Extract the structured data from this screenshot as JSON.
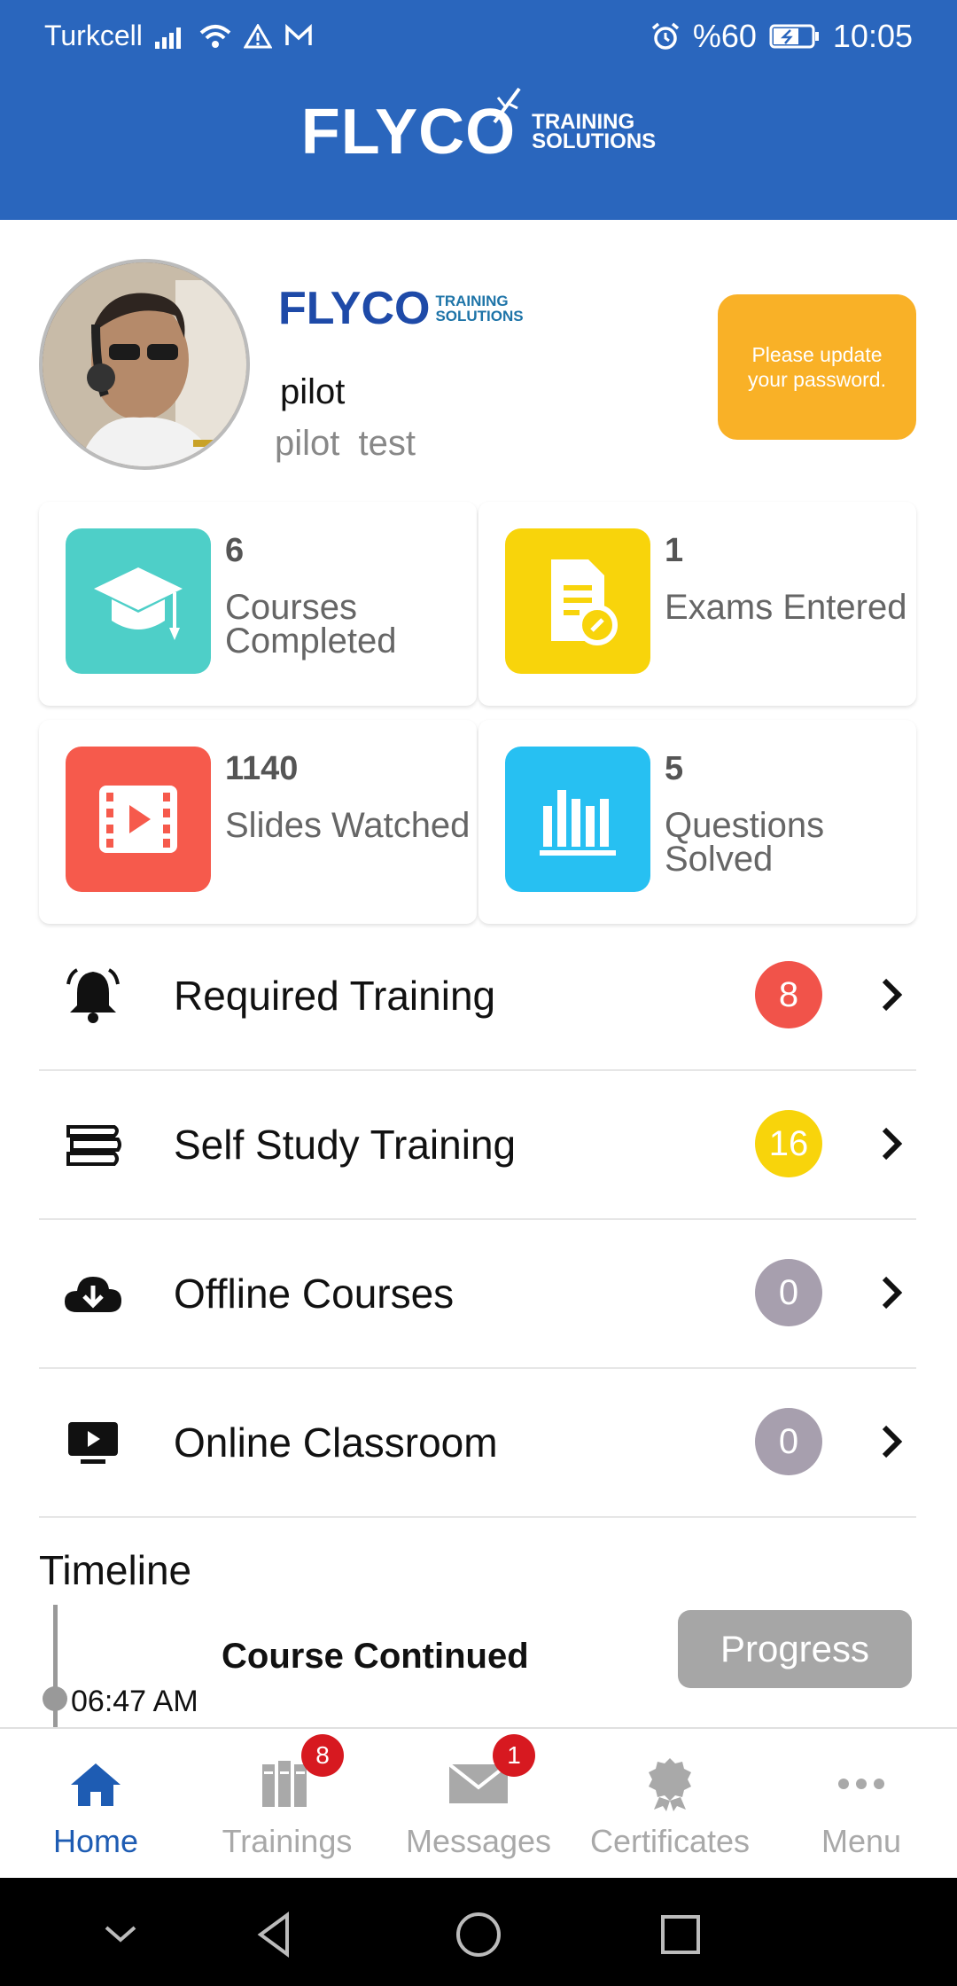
{
  "status_bar": {
    "carrier": "Turkcell",
    "battery": "%60",
    "time": "10:05"
  },
  "header": {
    "brand_word": "FLYCO",
    "brand_line1": "TRAINING",
    "brand_line2": "SOLUTIONS"
  },
  "profile": {
    "brand_word": "FLYCO",
    "brand_line1": "TRAINING",
    "brand_line2": "SOLUTIONS",
    "username": "pilot",
    "full_name": "pilot  test",
    "password_notice": "Please update your password."
  },
  "stats": [
    {
      "value": "6",
      "label": "Courses Completed",
      "icon": "graduation-cap-icon",
      "color": "#4ecfc8"
    },
    {
      "value": "1",
      "label": "Exams Entered",
      "icon": "exam-document-icon",
      "color": "#f8d40b"
    },
    {
      "value": "1140",
      "label": "Slides Watched",
      "icon": "video-slides-icon",
      "color": "#f65a4c"
    },
    {
      "value": "5",
      "label": "Questions Solved",
      "icon": "bar-chart-icon",
      "color": "#27c0f2"
    }
  ],
  "menu": [
    {
      "label": "Required Training",
      "count": "8",
      "icon": "bell-icon",
      "badge_color": "#f1534a"
    },
    {
      "label": "Self Study Training",
      "count": "16",
      "icon": "books-icon",
      "badge_color": "#f8d40b"
    },
    {
      "label": "Offline Courses",
      "count": "0",
      "icon": "cloud-download-icon",
      "badge_color": "#a79fae"
    },
    {
      "label": "Online Classroom",
      "count": "0",
      "icon": "video-screen-icon",
      "badge_color": "#a79fae"
    }
  ],
  "timeline": {
    "title": "Timeline",
    "event": "Course Continued",
    "time": "06:47 AM",
    "action": "Progress"
  },
  "bottom_nav": {
    "tabs": [
      {
        "label": "Home",
        "icon": "home-icon",
        "active": true
      },
      {
        "label": "Trainings",
        "icon": "books-icon",
        "badge": "8"
      },
      {
        "label": "Messages",
        "icon": "envelope-icon",
        "badge": "1"
      },
      {
        "label": "Certificates",
        "icon": "certificate-icon"
      },
      {
        "label": "Menu",
        "icon": "more-dots-icon"
      }
    ]
  },
  "colors": {
    "brand_blue": "#2a66bd",
    "active_tab": "#1e5cb3",
    "warning": "#f9b127"
  }
}
